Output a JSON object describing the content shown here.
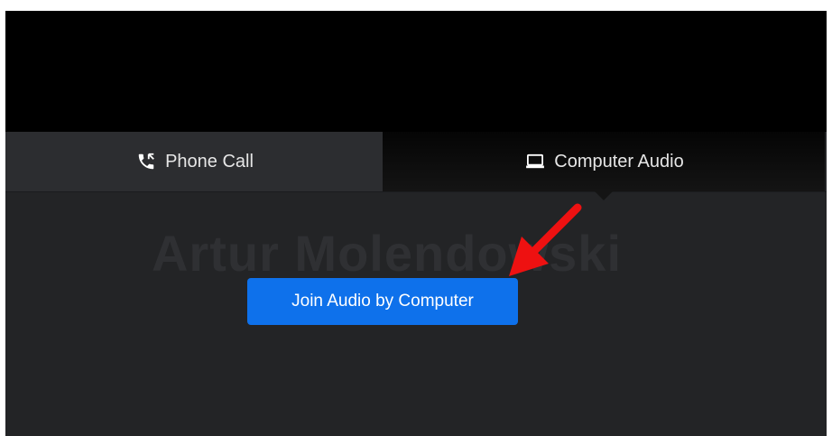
{
  "video": {},
  "tabs": [
    {
      "label": "Phone Call",
      "icon": "phone-icon",
      "selected": false
    },
    {
      "label": "Computer Audio",
      "icon": "laptop-icon",
      "selected": true
    }
  ],
  "participant": {
    "name": "Artur Molendowski"
  },
  "join_button": {
    "label": "Join Audio by Computer",
    "color": "#0e71eb"
  },
  "annotation": {
    "icon": "red-arrow-icon",
    "color": "#ee1111"
  }
}
